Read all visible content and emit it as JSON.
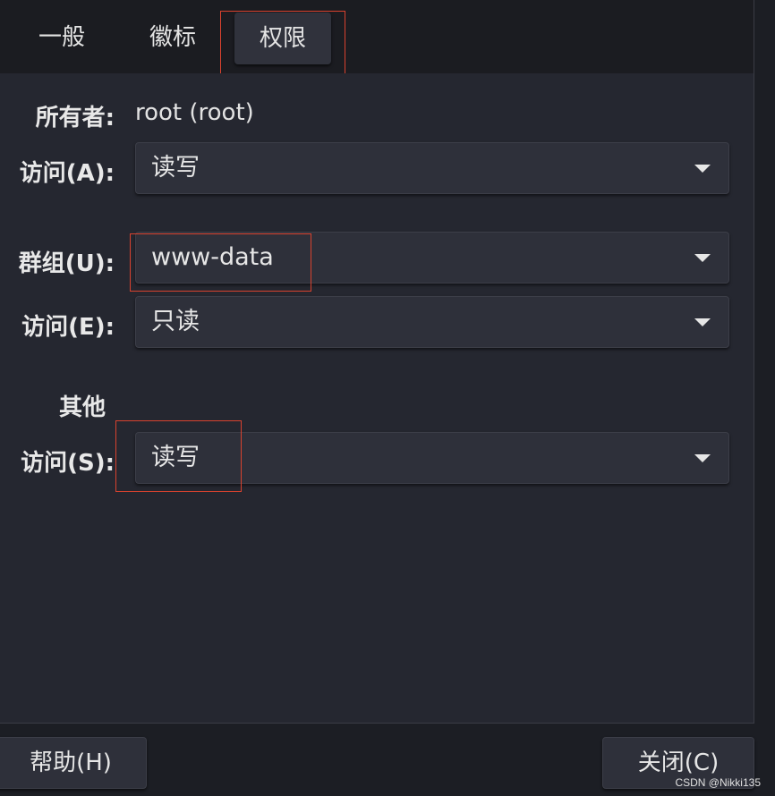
{
  "tabs": {
    "general": "一般",
    "emblem": "徽标",
    "permissions": "权限"
  },
  "owner": {
    "label": "所有者:",
    "value": "root (root)",
    "access_label": "访问(A):",
    "access_value": "读写"
  },
  "group": {
    "label": "群组(U):",
    "value": "www-data",
    "access_label": "访问(E):",
    "access_value": "只读"
  },
  "others": {
    "heading": "其他",
    "access_label": "访问(S):",
    "access_value": "读写"
  },
  "footer": {
    "help_label": "帮助(H)",
    "close_label": "关闭(C)"
  },
  "watermark": "CSDN @Nikki135",
  "colors": {
    "highlight": "#d9422e",
    "background": "#252730",
    "combo": "#2e303a"
  }
}
